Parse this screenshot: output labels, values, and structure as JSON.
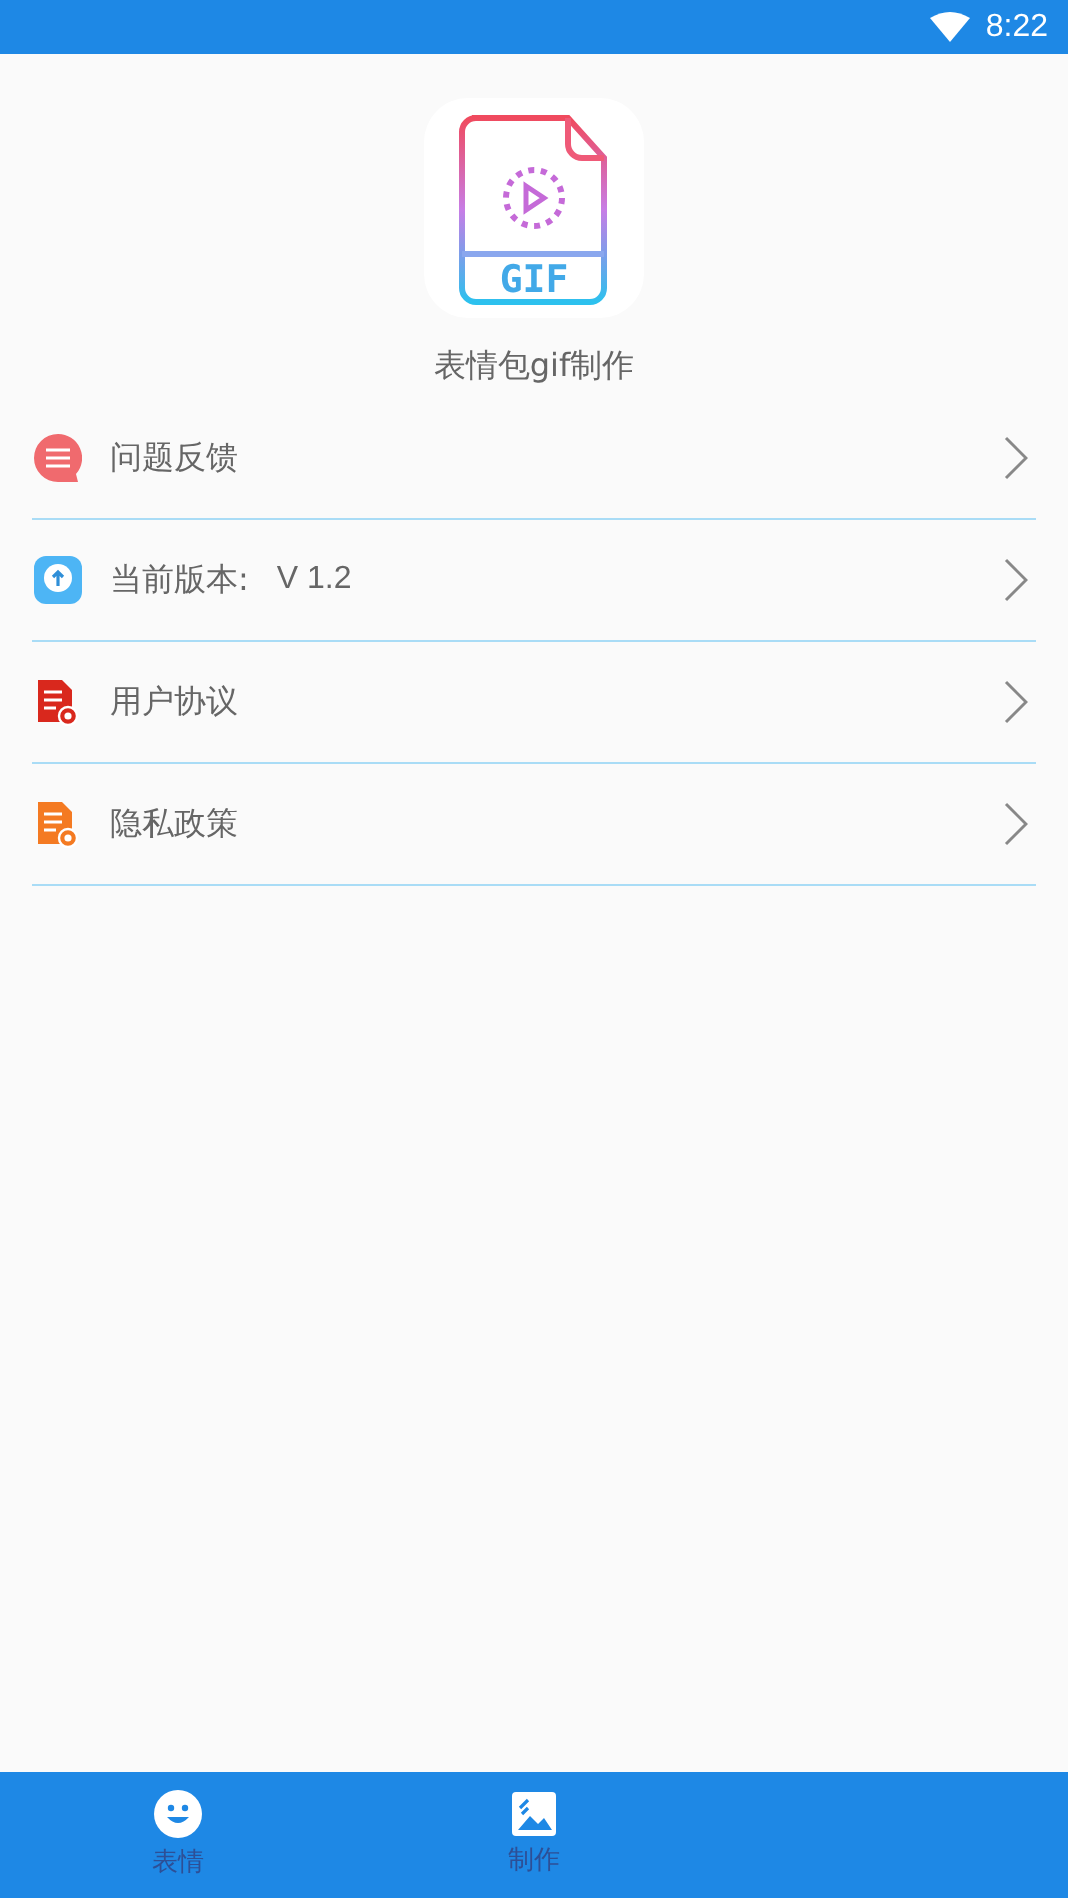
{
  "status_bar": {
    "time": "8:22"
  },
  "app": {
    "logo_text": "GIF",
    "name": "表情包gif制作"
  },
  "menu": [
    {
      "kind": "feedback",
      "label": "问题反馈"
    },
    {
      "kind": "version",
      "label": "当前版本:",
      "value": "V 1.2"
    },
    {
      "kind": "agreement",
      "label": "用户协议"
    },
    {
      "kind": "privacy",
      "label": "隐私政策"
    }
  ],
  "tabs": [
    {
      "kind": "emoji",
      "label": "表情",
      "selected": false
    },
    {
      "kind": "image",
      "label": "制作",
      "selected": false
    }
  ]
}
